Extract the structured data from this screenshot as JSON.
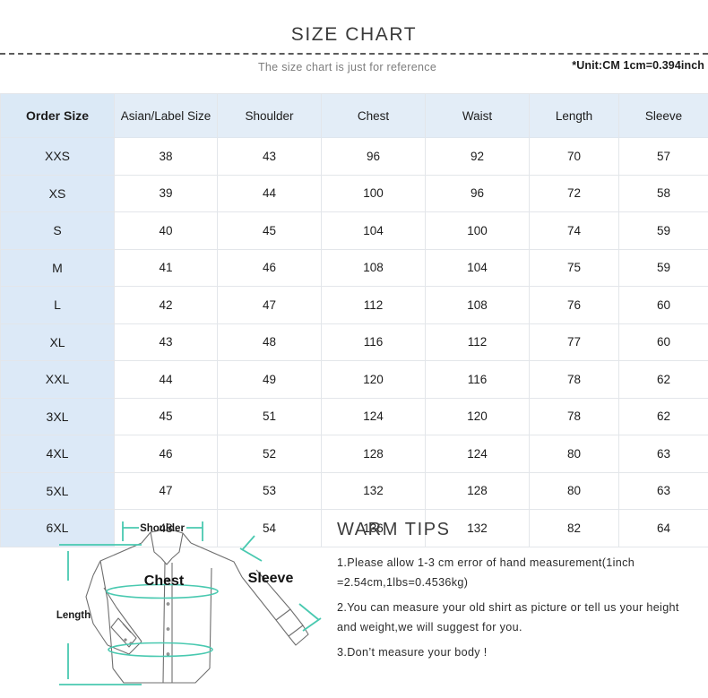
{
  "header": {
    "title": "SIZE CHART",
    "subtitle": "The size chart is just for reference",
    "unit_note": "*Unit:CM 1cm=0.394inch"
  },
  "table": {
    "columns": [
      "Order Size",
      "Asian/Label Size",
      "Shoulder",
      "Chest",
      "Waist",
      "Length",
      "Sleeve"
    ],
    "rows": [
      {
        "order": "XXS",
        "asian": "38",
        "shoulder": "43",
        "chest": "96",
        "waist": "92",
        "length": "70",
        "sleeve": "57"
      },
      {
        "order": "XS",
        "asian": "39",
        "shoulder": "44",
        "chest": "100",
        "waist": "96",
        "length": "72",
        "sleeve": "58"
      },
      {
        "order": "S",
        "asian": "40",
        "shoulder": "45",
        "chest": "104",
        "waist": "100",
        "length": "74",
        "sleeve": "59"
      },
      {
        "order": "M",
        "asian": "41",
        "shoulder": "46",
        "chest": "108",
        "waist": "104",
        "length": "75",
        "sleeve": "59"
      },
      {
        "order": "L",
        "asian": "42",
        "shoulder": "47",
        "chest": "112",
        "waist": "108",
        "length": "76",
        "sleeve": "60"
      },
      {
        "order": "XL",
        "asian": "43",
        "shoulder": "48",
        "chest": "116",
        "waist": "112",
        "length": "77",
        "sleeve": "60"
      },
      {
        "order": "XXL",
        "asian": "44",
        "shoulder": "49",
        "chest": "120",
        "waist": "116",
        "length": "78",
        "sleeve": "62"
      },
      {
        "order": "3XL",
        "asian": "45",
        "shoulder": "51",
        "chest": "124",
        "waist": "120",
        "length": "78",
        "sleeve": "62"
      },
      {
        "order": "4XL",
        "asian": "46",
        "shoulder": "52",
        "chest": "128",
        "waist": "124",
        "length": "80",
        "sleeve": "63"
      },
      {
        "order": "5XL",
        "asian": "47",
        "shoulder": "53",
        "chest": "132",
        "waist": "128",
        "length": "80",
        "sleeve": "63"
      },
      {
        "order": "6XL",
        "asian": "48",
        "shoulder": "54",
        "chest": "136",
        "waist": "132",
        "length": "82",
        "sleeve": "64"
      }
    ]
  },
  "diagram": {
    "labels": {
      "shoulder": "Shoulder",
      "chest": "Chest",
      "sleeve": "Sleeve",
      "length": "Length"
    },
    "measure_color": "#49c9b0",
    "outline_color": "#6f6f6f"
  },
  "tips": {
    "heading": "WARM TIPS",
    "lines": [
      "1.Please allow 1-3 cm error of hand measurement(1inch =2.54cm,1lbs=0.4536kg)",
      "2.You can measure your old shirt as picture or tell us your height and weight,we will suggest for you.",
      "3.Don’t measure your body !"
    ]
  },
  "colors": {
    "header_blue": "#e3edf7",
    "order_col_blue": "#dce9f7",
    "border": "#e3e6ea",
    "title_gray": "#3a3a3a",
    "subtitle_gray": "#7d7d7d"
  }
}
